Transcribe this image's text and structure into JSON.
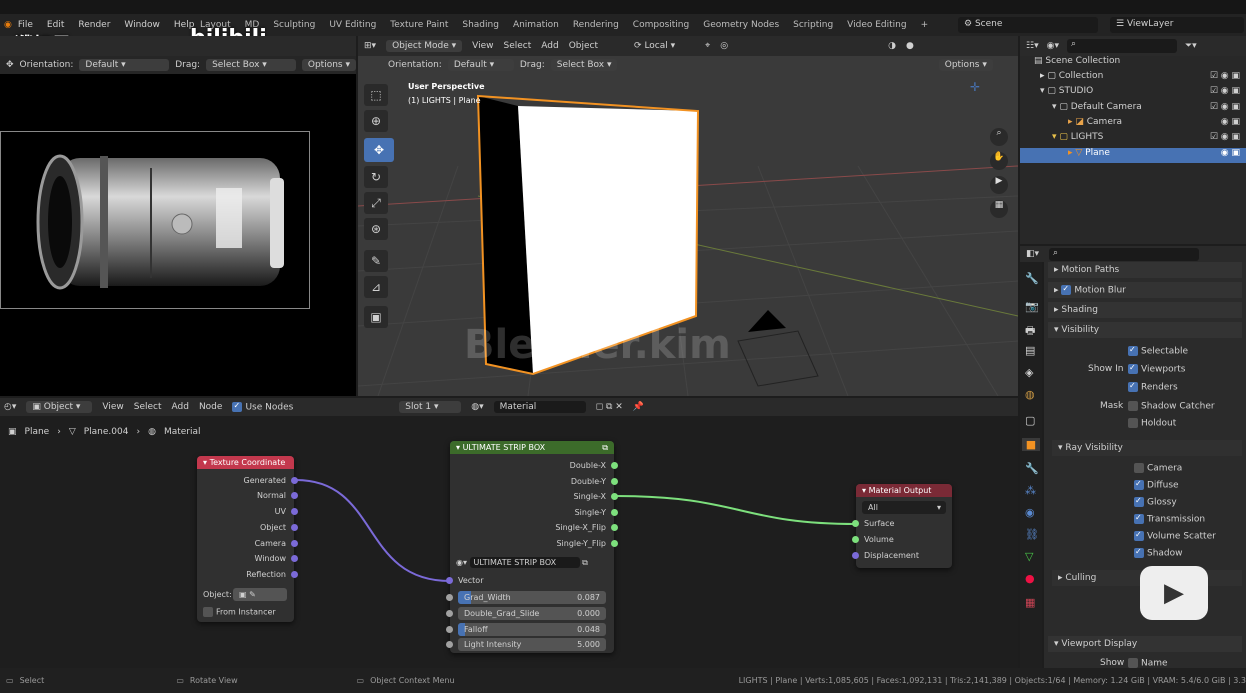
{
  "topbar": {
    "menus": [
      "File",
      "Edit",
      "Render",
      "Window",
      "Help"
    ],
    "workspaces": [
      "Layout",
      "UV Editing",
      "Texture Paint",
      "Shading",
      "Animation",
      "Rendering",
      "Compositing",
      "Geometry Nodes",
      "Scripting",
      "Video Editing"
    ],
    "partial_tabs": [
      "MD",
      "Sculpting"
    ],
    "add_tab": "+",
    "scene": "Scene",
    "view_layer": "ViewLayer"
  },
  "overlay": {
    "author": "濮炽君wyman",
    "site": "bilibili",
    "watermark": "Blender.kim"
  },
  "left_panel": {
    "orientation_label": "Orientation:",
    "orientation_value": "Default",
    "drag_label": "Drag:",
    "drag_value": "Select Box",
    "options": "Options"
  },
  "viewport": {
    "mode": "Object Mode",
    "menus": [
      "View",
      "Select",
      "Add",
      "Object"
    ],
    "transform": "Local",
    "orientation_label": "Orientation:",
    "orientation_value": "Default",
    "drag_label": "Drag:",
    "drag_value": "Select Box",
    "options": "Options",
    "info_line1": "User Perspective",
    "info_line2": "(1) LIGHTS | Plane"
  },
  "outliner": {
    "title": "Scene Collection",
    "items": [
      {
        "label": "Collection",
        "indent": 1
      },
      {
        "label": "STUDIO",
        "indent": 1
      },
      {
        "label": "Default Camera",
        "indent": 2
      },
      {
        "label": "Camera",
        "indent": 3
      },
      {
        "label": "LIGHTS",
        "indent": 2
      },
      {
        "label": "Plane",
        "indent": 3,
        "selected": true
      }
    ]
  },
  "properties": {
    "sections": [
      "Motion Paths",
      "Motion Blur",
      "Shading",
      "Visibility"
    ],
    "selectable": "Selectable",
    "show_in_label": "Show In",
    "viewports": "Viewports",
    "renders": "Renders",
    "mask_label": "Mask",
    "shadow_catcher": "Shadow Catcher",
    "holdout": "Holdout",
    "ray_visibility": "Ray Visibility",
    "rays": [
      {
        "label": "Camera",
        "checked": false
      },
      {
        "label": "Diffuse",
        "checked": true
      },
      {
        "label": "Glossy",
        "checked": true
      },
      {
        "label": "Transmission",
        "checked": true
      },
      {
        "label": "Volume Scatter",
        "checked": true
      },
      {
        "label": "Shadow",
        "checked": true
      }
    ],
    "culling": "Culling",
    "viewport_display": "Viewport Display",
    "show_label": "Show",
    "name": "Name"
  },
  "node_editor": {
    "object_menu": "Object",
    "menus": [
      "View",
      "Select",
      "Add",
      "Node"
    ],
    "use_nodes": "Use Nodes",
    "slot": "Slot 1",
    "material": "Material",
    "breadcrumb": [
      "Plane",
      "Plane.004",
      "Material"
    ]
  },
  "nodes": {
    "texcoord": {
      "title": "Texture Coordinate",
      "outputs": [
        "Generated",
        "Normal",
        "UV",
        "Object",
        "Camera",
        "Window",
        "Reflection"
      ],
      "object_label": "Object:",
      "from_instancer": "From Instancer"
    },
    "strip": {
      "title": "ULTIMATE STRIP BOX",
      "outputs": [
        "Double-X",
        "Double-Y",
        "Single-X",
        "Single-Y",
        "Single-X_Flip",
        "Single-Y_Flip"
      ],
      "group": "ULTIMATE STRIP BOX",
      "vector": "Vector",
      "inputs": [
        {
          "label": "Grad_Width",
          "value": "0.087",
          "fill": 0.087
        },
        {
          "label": "Double_Grad_Slide",
          "value": "0.000",
          "fill": 0
        },
        {
          "label": "Falloff",
          "value": "0.048",
          "fill": 0.048
        },
        {
          "label": "Light Intensity",
          "value": "5.000",
          "fill": 0
        }
      ]
    },
    "output": {
      "title": "Material Output",
      "target": "All",
      "inputs": [
        "Surface",
        "Volume",
        "Displacement"
      ]
    }
  },
  "statusbar": {
    "select": "Select",
    "rotate": "Rotate View",
    "context": "Object Context Menu",
    "stats": "LIGHTS | Plane | Verts:1,085,605 | Faces:1,092,131 | Tris:2,141,389 | Objects:1/64 | Memory: 1.24 GiB | VRAM: 5.4/6.0 GiB | 3.3"
  },
  "colors": {
    "accent": "#4772b3",
    "selection_orange": "#f29222",
    "node_texcoord": "#c3384d",
    "node_group": "#3c6b2a",
    "node_output": "#7a2a36"
  }
}
